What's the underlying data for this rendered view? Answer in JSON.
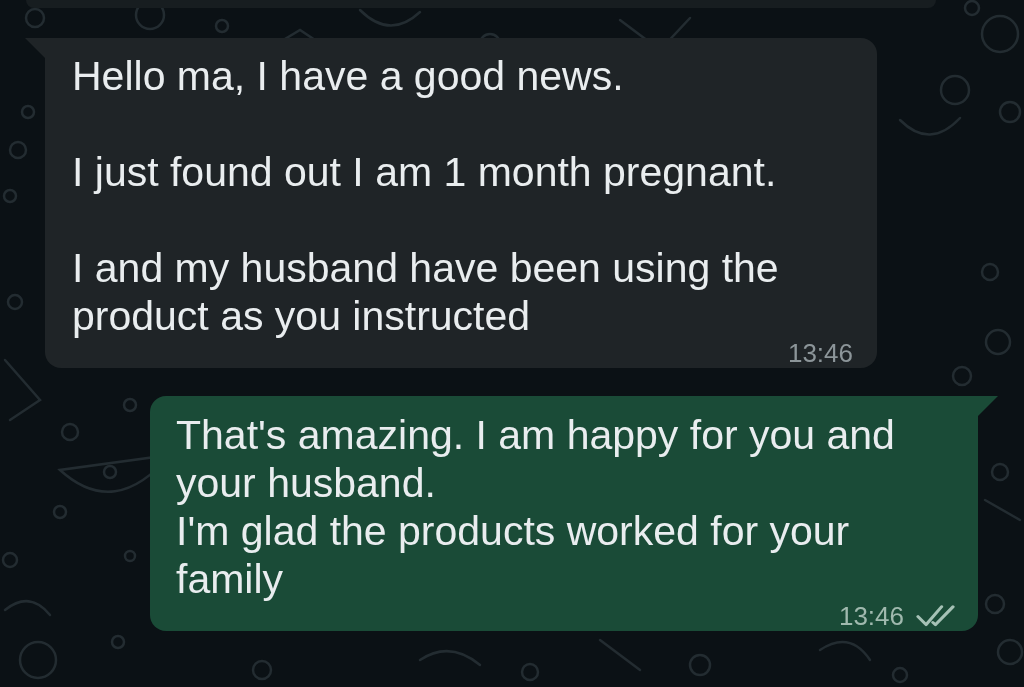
{
  "messages": [
    {
      "kind": "incoming",
      "text": "Hello ma, I have a good news.\n\nI just found out I am 1 month pregnant.\n\nI and my husband have been using the product as you instructed",
      "time": "13:46"
    },
    {
      "kind": "outgoing",
      "text": "That's amazing. I am happy for you and your husband.\nI'm glad the products worked for your family",
      "time": "13:46",
      "delivered": true,
      "read": false
    }
  ]
}
